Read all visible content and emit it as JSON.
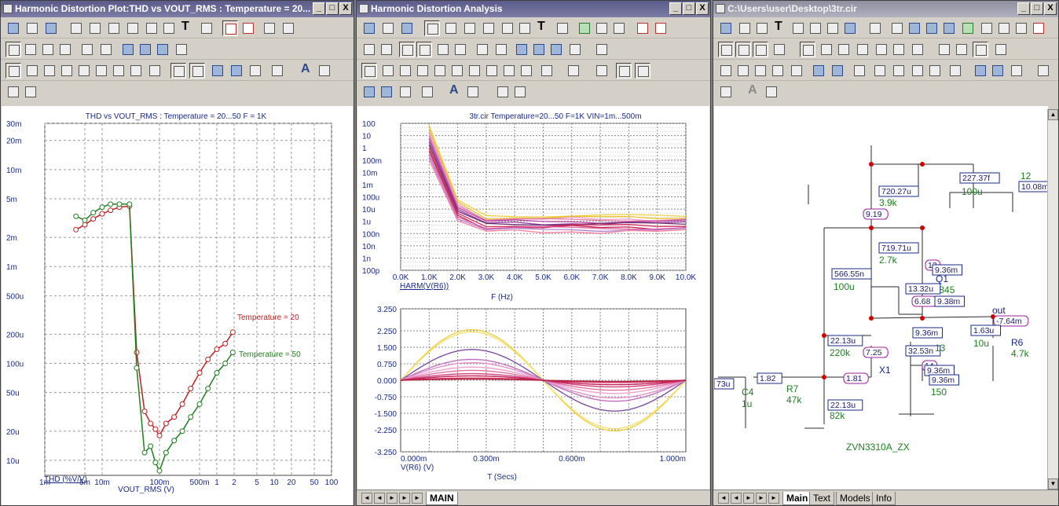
{
  "windows": {
    "left": {
      "title": "Harmonic Distortion Plot:THD vs VOUT_RMS : Temperature = 20..."
    },
    "middle": {
      "title": "Harmonic Distortion Analysis"
    },
    "right": {
      "title": "C:\\Users\\user\\Desktop\\3tr.cir"
    }
  },
  "window_buttons": {
    "minimize": "_",
    "maximize": "□",
    "close": "X"
  },
  "chart_data": [
    {
      "type": "line",
      "title": "THD vs VOUT_RMS : Temperature = 20...50 F = 1K",
      "xlabel": "VOUT_RMS (V)",
      "ylabel": "THD (%V/V)",
      "xscale": "log",
      "yscale": "log",
      "xlim": [
        0.001,
        100
      ],
      "ylim": [
        7e-06,
        0.03
      ],
      "x_ticks": [
        "1m",
        "5m",
        "10m",
        "100m",
        "500m",
        "1",
        "2",
        "5",
        "10",
        "20",
        "50",
        "100"
      ],
      "y_ticks": [
        "30m",
        "20m",
        "10m",
        "5m",
        "2m",
        "1m",
        "500u",
        "200u",
        "100u",
        "50u",
        "20u",
        "10u"
      ],
      "series": [
        {
          "name": "Temperature = 20",
          "color": "#c02020",
          "x": [
            0.0035,
            0.005,
            0.007,
            0.01,
            0.014,
            0.02,
            0.03,
            0.04,
            0.055,
            0.07,
            0.085,
            0.1,
            0.13,
            0.18,
            0.25,
            0.35,
            0.5,
            0.7,
            1.0,
            1.4,
            1.9
          ],
          "y": [
            0.0024,
            0.0027,
            0.0031,
            0.0035,
            0.0038,
            0.0041,
            0.0042,
            0.00013,
            3.2e-05,
            2.4e-05,
            2.1e-05,
            1.8e-05,
            2.4e-05,
            2.8e-05,
            3.8e-05,
            5.5e-05,
            8e-05,
            0.00011,
            0.00014,
            0.00016,
            0.00021
          ]
        },
        {
          "name": "Temperature = 50",
          "color": "#208020",
          "x": [
            0.0035,
            0.005,
            0.007,
            0.01,
            0.014,
            0.02,
            0.03,
            0.04,
            0.055,
            0.07,
            0.085,
            0.1,
            0.13,
            0.18,
            0.25,
            0.35,
            0.5,
            0.7,
            1.0,
            1.4,
            1.9
          ],
          "y": [
            0.0033,
            0.003,
            0.0036,
            0.0041,
            0.0044,
            0.0044,
            0.0044,
            9e-05,
            1.2e-05,
            1.4e-05,
            9.5e-06,
            7.8e-06,
            1.2e-05,
            1.6e-05,
            2e-05,
            2.8e-05,
            3.8e-05,
            5.5e-05,
            8e-05,
            0.0001,
            0.00013
          ]
        }
      ]
    },
    {
      "type": "line",
      "title": "3tr.cir Temperature=20...50 F=1K VIN=1m...500m",
      "xlabel": "F (Hz)",
      "ylabel": "HARM(V(R6))",
      "yscale": "log",
      "x_ticks": [
        "0.0K",
        "1.0K",
        "2.0K",
        "3.0K",
        "4.0K",
        "5.0K",
        "6.0K",
        "7.0K",
        "8.0K",
        "9.0K",
        "10.0K"
      ],
      "y_ticks": [
        "100",
        "10",
        "1",
        "100m",
        "10m",
        "1m",
        "100u",
        "10u",
        "1u",
        "100n",
        "10n",
        "1n",
        "100p"
      ]
    },
    {
      "type": "line",
      "xlabel": "T (Secs)",
      "ylabel": "V(R6) (V)",
      "xlim": [
        0,
        0.001
      ],
      "ylim": [
        -3.25,
        3.25
      ],
      "x_ticks": [
        "0.000m",
        "0.300m",
        "0.600m",
        "1.000m"
      ],
      "y_ticks": [
        "3.250",
        "2.250",
        "1.500",
        "0.750",
        "0.000",
        "-0.750",
        "-1.500",
        "-2.250",
        "-3.250"
      ]
    }
  ],
  "middle_tabs": [
    "MAIN"
  ],
  "right_tabs": [
    "Main",
    "Text",
    "Models",
    "Info"
  ],
  "schematic": {
    "labels": {
      "c1_val": "227.37f",
      "n12": "12",
      "v12": "10.08m",
      "c_100u_top": "100u",
      "r_top_i": "720.27u",
      "r_top_v": "3.9k",
      "n919": "9.19",
      "r2_i": "719.71u",
      "r2_v": "2.7k",
      "n13": "13",
      "c_mid_i": "566.55n",
      "c_mid_v": "100u",
      "q1_v": "9.36m",
      "q1": "Q1",
      "q1_model": "KSC1845",
      "q1_i": "13.32u",
      "n668": "6.68",
      "n938": "9.38m",
      "out": "out",
      "out_v": "-7.64m",
      "c_out_i": "1.63u",
      "c_out_v": "10u",
      "r6": "R6",
      "r6_v": "4.7k",
      "r220_i": "22.13u",
      "r220_v": "220k",
      "n725": "7.25",
      "x1_v1": "9.36m",
      "x1_v2": "32.53n",
      "x1_n": "13",
      "x1": "X1",
      "n181": "1.81",
      "n182": "1.82",
      "left_i": "73u",
      "c4": "C4",
      "c4_v": "1u",
      "r7": "R7",
      "r7_v": "47k",
      "r82_i": "22.13u",
      "r82_v": "82k",
      "j_v1": "9.36m",
      "j_v2": "9.36m",
      "j_v3": "150",
      "j_n": "14",
      "part": "ZVN3310A_ZX"
    }
  }
}
